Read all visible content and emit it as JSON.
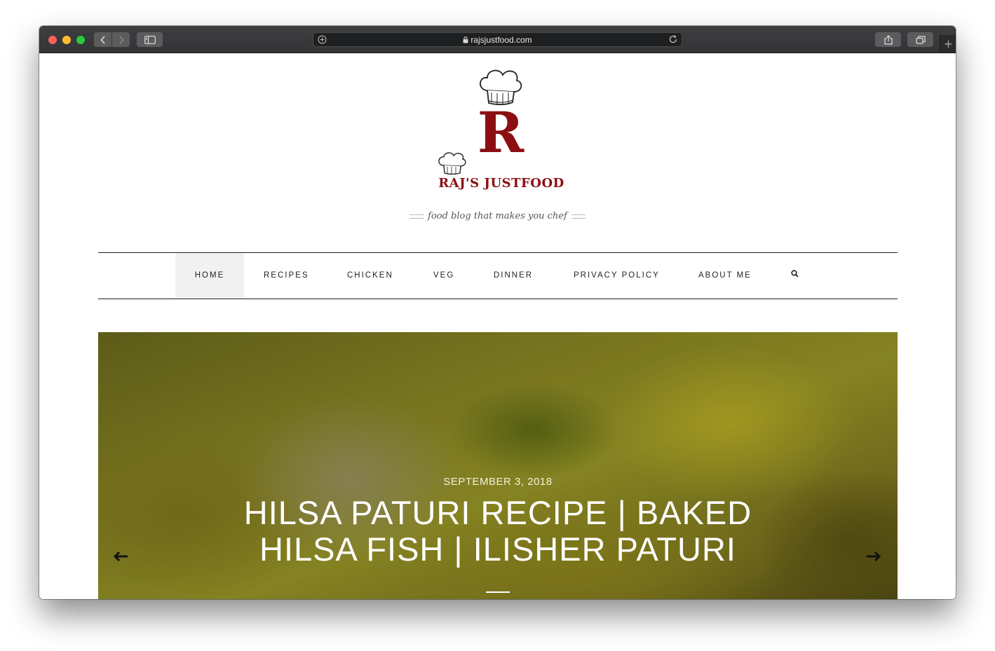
{
  "browser": {
    "url": "rajsjustfood.com"
  },
  "site": {
    "logo_text": "RAJ'S JUSTFOOD",
    "logo_letter": "R",
    "tagline": "food blog that makes you chef",
    "brand_color": "#8b0e12"
  },
  "nav": {
    "items": [
      {
        "label": "HOME",
        "active": true
      },
      {
        "label": "RECIPES"
      },
      {
        "label": "CHICKEN"
      },
      {
        "label": "VEG"
      },
      {
        "label": "DINNER"
      },
      {
        "label": "PRIVACY POLICY"
      },
      {
        "label": "ABOUT ME"
      }
    ],
    "search_icon": "search-icon"
  },
  "hero": {
    "date": "SEPTEMBER 3, 2018",
    "title": "HILSA PATURI RECIPE | BAKED HILSA FISH | ILISHER PATURI",
    "prev_icon": "arrow-left-icon",
    "next_icon": "arrow-right-icon"
  }
}
